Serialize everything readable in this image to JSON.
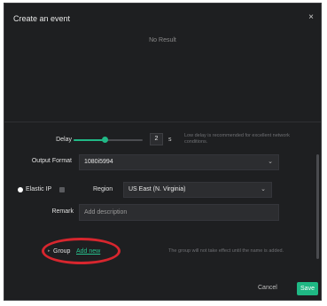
{
  "dialog": {
    "title": "Create an event",
    "close_glyph": "×",
    "cutoff_text": "' ' ' '",
    "no_result": "No Result"
  },
  "form": {
    "delay": {
      "label": "Delay",
      "value": "2",
      "unit": "s",
      "slider_fraction": 0.45,
      "hint": "Low delay is recommended for excellent network conditions."
    },
    "output_format": {
      "label": "Output Format",
      "value": "1080i5994"
    },
    "elastic_ip": {
      "label": "Elastic IP"
    },
    "region": {
      "label": "Region",
      "value": "US East (N. Virginia)"
    },
    "remark": {
      "label": "Remark",
      "placeholder": "Add description"
    },
    "group": {
      "caret": "▸",
      "label": "Group",
      "add_new": "Add new",
      "hint": "The group will not take effect until the name is added."
    }
  },
  "footer": {
    "cancel_label": "Cancel",
    "save_label": "Save"
  },
  "icons": {
    "close": "close-icon",
    "chevron": "chevron-down-icon",
    "caret": "caret-right-icon"
  },
  "colors": {
    "accent": "#1fb884",
    "link": "#27c28e",
    "annotation": "#d7262e",
    "background": "#1e1f21"
  }
}
